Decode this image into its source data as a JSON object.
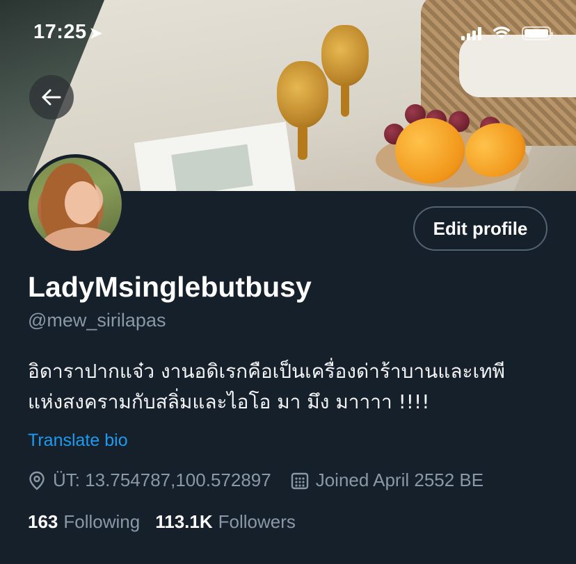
{
  "status_bar": {
    "time": "17:25",
    "location_icon": "location-arrow-icon",
    "signal_icon": "cellular-signal-icon",
    "wifi_icon": "wifi-icon",
    "battery_icon": "battery-icon"
  },
  "header": {
    "back_icon": "arrow-left-icon",
    "banner_description": "photo-banner"
  },
  "profile": {
    "edit_button_label": "Edit profile",
    "display_name": "LadyMsinglebutbusy",
    "handle": "@mew_sirilapas",
    "bio_lines": [
      "อิดาราปากแจ๋ว งานอดิเรกคือเป็นเครื่องด่าร้าบานและเทพี",
      "แห่งสงครามกับสลิ่มและไอโอ มา มึง มาาาา !!!!"
    ],
    "translate_link": "Translate bio",
    "location": "ÜT: 13.754787,100.572897",
    "joined": "Joined April 2552 BE",
    "following_count": "163",
    "following_label": "Following",
    "followers_count": "113.1K",
    "followers_label": "Followers"
  },
  "colors": {
    "background": "#15202b",
    "accent": "#1d9bf0",
    "secondary_text": "#8b98a5"
  }
}
